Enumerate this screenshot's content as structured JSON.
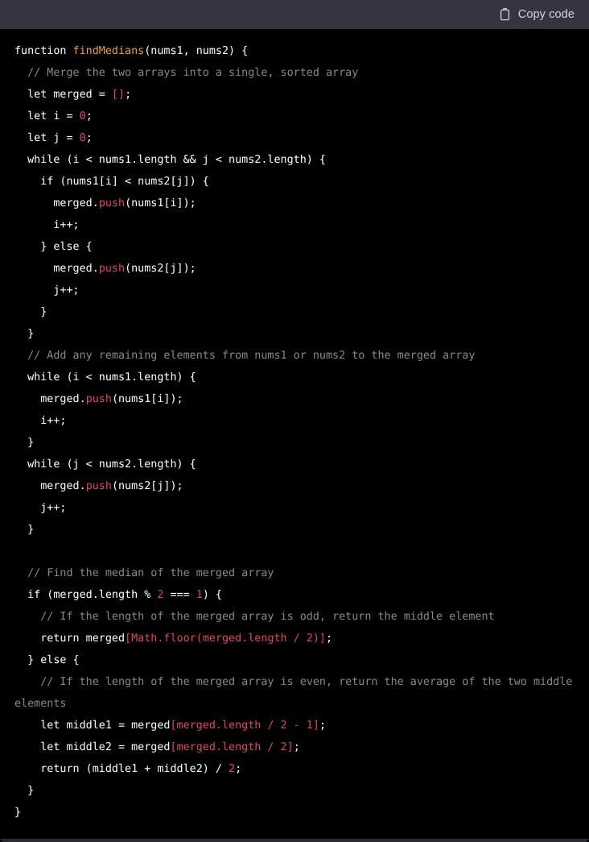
{
  "header": {
    "copy_label": "Copy code",
    "copy_icon": "clipboard-icon"
  },
  "colors": {
    "header_bg": "#343541",
    "code_bg": "#000000",
    "default_text": "#ffffff",
    "comment": "#8a8a8a",
    "function_name": "#e8a33d",
    "number": "#e0456a",
    "bracket_expression": "#e0456a",
    "method": "#e0456a",
    "copy_label_color": "#d1d5db"
  },
  "code": {
    "language": "javascript",
    "lines": [
      [
        {
          "t": "function ",
          "c": "def"
        },
        {
          "t": "findMedians",
          "c": "fn"
        },
        {
          "t": "(nums1, nums2) {",
          "c": "def"
        }
      ],
      [
        {
          "t": "  // Merge the two arrays into a single, sorted array",
          "c": "com"
        }
      ],
      [
        {
          "t": "  let merged = ",
          "c": "def"
        },
        {
          "t": "[]",
          "c": "brk"
        },
        {
          "t": ";",
          "c": "def"
        }
      ],
      [
        {
          "t": "  let i = ",
          "c": "def"
        },
        {
          "t": "0",
          "c": "num"
        },
        {
          "t": ";",
          "c": "def"
        }
      ],
      [
        {
          "t": "  let j = ",
          "c": "def"
        },
        {
          "t": "0",
          "c": "num"
        },
        {
          "t": ";",
          "c": "def"
        }
      ],
      [
        {
          "t": "  while (i < nums1.length && j < nums2.length) {",
          "c": "def"
        }
      ],
      [
        {
          "t": "    if (nums1[i] < nums2[j]) {",
          "c": "def"
        }
      ],
      [
        {
          "t": "      merged.",
          "c": "def"
        },
        {
          "t": "push",
          "c": "mem"
        },
        {
          "t": "(nums1[i]);",
          "c": "def"
        }
      ],
      [
        {
          "t": "      i++;",
          "c": "def"
        }
      ],
      [
        {
          "t": "    } else {",
          "c": "def"
        }
      ],
      [
        {
          "t": "      merged.",
          "c": "def"
        },
        {
          "t": "push",
          "c": "mem"
        },
        {
          "t": "(nums2[j]);",
          "c": "def"
        }
      ],
      [
        {
          "t": "      j++;",
          "c": "def"
        }
      ],
      [
        {
          "t": "    }",
          "c": "def"
        }
      ],
      [
        {
          "t": "  }",
          "c": "def"
        }
      ],
      [
        {
          "t": "  // Add any remaining elements from nums1 or nums2 to the merged array",
          "c": "com"
        }
      ],
      [
        {
          "t": "  while (i < nums1.length) {",
          "c": "def"
        }
      ],
      [
        {
          "t": "    merged.",
          "c": "def"
        },
        {
          "t": "push",
          "c": "mem"
        },
        {
          "t": "(nums1[i]);",
          "c": "def"
        }
      ],
      [
        {
          "t": "    i++;",
          "c": "def"
        }
      ],
      [
        {
          "t": "  }",
          "c": "def"
        }
      ],
      [
        {
          "t": "  while (j < nums2.length) {",
          "c": "def"
        }
      ],
      [
        {
          "t": "    merged.",
          "c": "def"
        },
        {
          "t": "push",
          "c": "mem"
        },
        {
          "t": "(nums2[j]);",
          "c": "def"
        }
      ],
      [
        {
          "t": "    j++;",
          "c": "def"
        }
      ],
      [
        {
          "t": "  }",
          "c": "def"
        }
      ],
      [
        {
          "t": "",
          "c": "def"
        }
      ],
      [
        {
          "t": "  // Find the median of the merged array",
          "c": "com"
        }
      ],
      [
        {
          "t": "  if (merged.length % ",
          "c": "def"
        },
        {
          "t": "2",
          "c": "num"
        },
        {
          "t": " === ",
          "c": "def"
        },
        {
          "t": "1",
          "c": "num"
        },
        {
          "t": ") {",
          "c": "def"
        }
      ],
      [
        {
          "t": "    // If the length of the merged array is odd, return the middle element",
          "c": "com"
        }
      ],
      [
        {
          "t": "    return merged",
          "c": "def"
        },
        {
          "t": "[Math.floor(merged.length / 2)]",
          "c": "brk"
        },
        {
          "t": ";",
          "c": "def"
        }
      ],
      [
        {
          "t": "  } else {",
          "c": "def"
        }
      ],
      [
        {
          "t": "    // If the length of the merged array is even, return the average of the two middle elements",
          "c": "com"
        }
      ],
      [
        {
          "t": "    let middle1 = merged",
          "c": "def"
        },
        {
          "t": "[merged.length / 2 - 1]",
          "c": "brk"
        },
        {
          "t": ";",
          "c": "def"
        }
      ],
      [
        {
          "t": "    let middle2 = merged",
          "c": "def"
        },
        {
          "t": "[merged.length / 2]",
          "c": "brk"
        },
        {
          "t": ";",
          "c": "def"
        }
      ],
      [
        {
          "t": "    return (middle1 + middle2) / ",
          "c": "def"
        },
        {
          "t": "2",
          "c": "num"
        },
        {
          "t": ";",
          "c": "def"
        }
      ],
      [
        {
          "t": "  }",
          "c": "def"
        }
      ],
      [
        {
          "t": "}",
          "c": "def"
        }
      ]
    ]
  }
}
